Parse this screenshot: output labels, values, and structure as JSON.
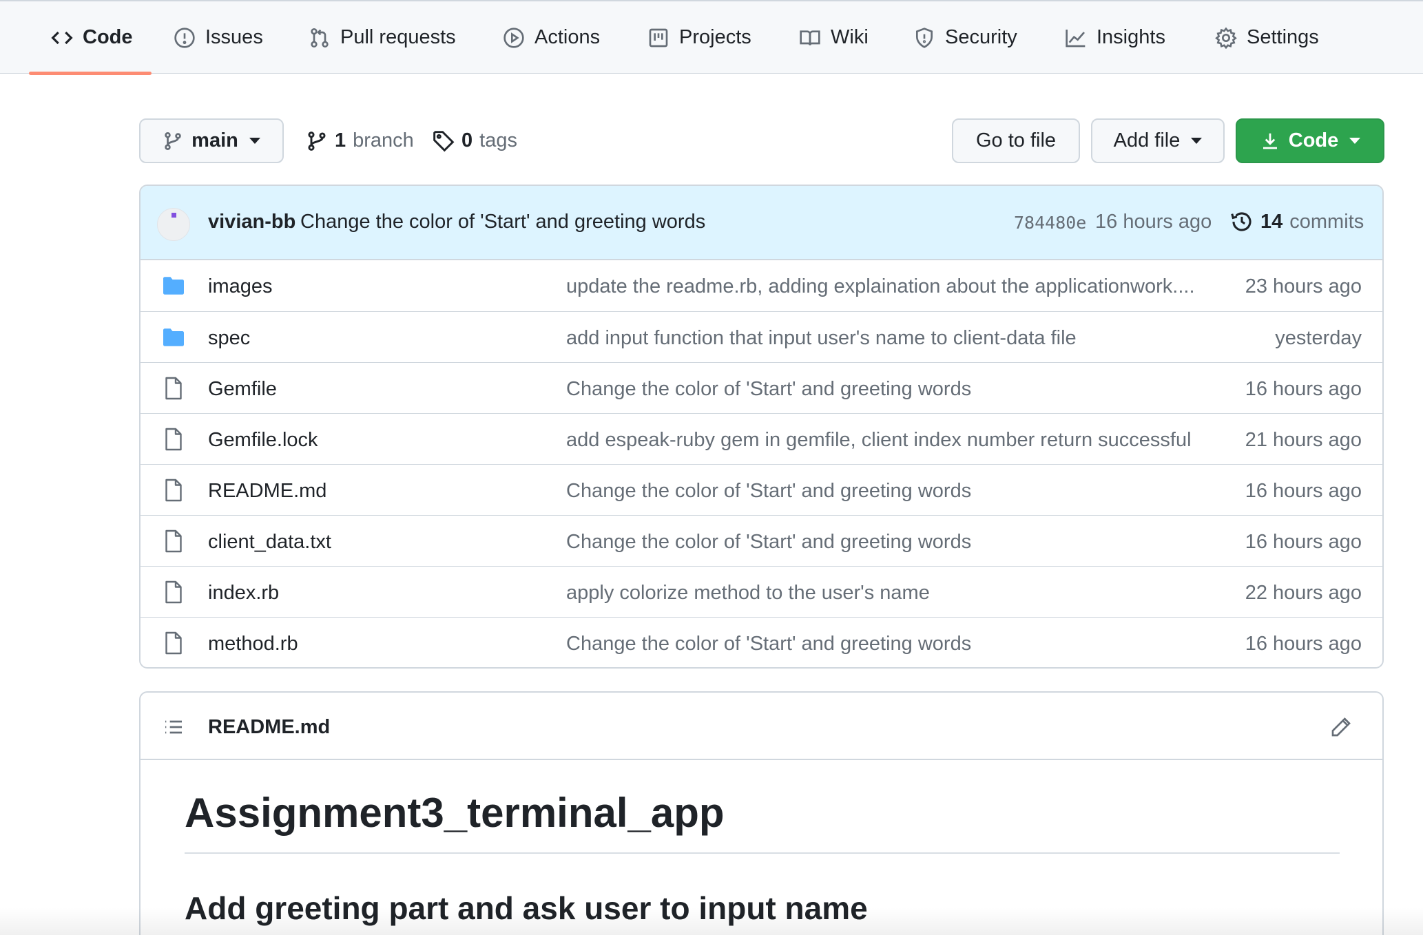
{
  "repo_nav": {
    "tabs": [
      {
        "label": "Code",
        "icon": "code-icon"
      },
      {
        "label": "Issues",
        "icon": "issue-icon"
      },
      {
        "label": "Pull requests",
        "icon": "pull-request-icon"
      },
      {
        "label": "Actions",
        "icon": "play-icon"
      },
      {
        "label": "Projects",
        "icon": "project-icon"
      },
      {
        "label": "Wiki",
        "icon": "book-icon"
      },
      {
        "label": "Security",
        "icon": "shield-icon"
      },
      {
        "label": "Insights",
        "icon": "graph-icon"
      },
      {
        "label": "Settings",
        "icon": "gear-icon"
      }
    ],
    "active_tab": "Code",
    "active_underline_color": "#fd8c73"
  },
  "branch_bar": {
    "branch_name": "main",
    "branch_count": "1",
    "branch_label": "branch",
    "tag_count": "0",
    "tag_label": "tags",
    "go_to_file_label": "Go to file",
    "add_file_label": "Add file",
    "code_label": "Code",
    "code_button_color": "#2da44e"
  },
  "latest_commit": {
    "author": "vivian-bb",
    "message": "Change the color of 'Start' and greeting words",
    "sha": "784480e",
    "age": "16 hours ago",
    "commit_count": "14",
    "commit_label": "commits"
  },
  "files": [
    {
      "type": "folder",
      "name": "images",
      "commit": "update the readme.rb, adding explaination about the applicationwork....",
      "age": "23 hours ago"
    },
    {
      "type": "folder",
      "name": "spec",
      "commit": "add input function that input user's name to client-data file",
      "age": "yesterday"
    },
    {
      "type": "file",
      "name": "Gemfile",
      "commit": "Change the color of 'Start' and greeting words",
      "age": "16 hours ago"
    },
    {
      "type": "file",
      "name": "Gemfile.lock",
      "commit": "add espeak-ruby gem in gemfile, client index number return successful",
      "age": "21 hours ago"
    },
    {
      "type": "file",
      "name": "README.md",
      "commit": "Change the color of 'Start' and greeting words",
      "age": "16 hours ago"
    },
    {
      "type": "file",
      "name": "client_data.txt",
      "commit": "Change the color of 'Start' and greeting words",
      "age": "16 hours ago"
    },
    {
      "type": "file",
      "name": "index.rb",
      "commit": "apply colorize method to the user's name",
      "age": "22 hours ago"
    },
    {
      "type": "file",
      "name": "method.rb",
      "commit": "Change the color of 'Start' and greeting words",
      "age": "16 hours ago"
    }
  ],
  "readme": {
    "filename": "README.md",
    "h1": "Assignment3_terminal_app",
    "h2": "Add greeting part and ask user to input name"
  },
  "colors": {
    "folder_icon": "#54aeff",
    "commit_bar_bg": "#ddf4ff",
    "muted_text": "#656d76"
  }
}
